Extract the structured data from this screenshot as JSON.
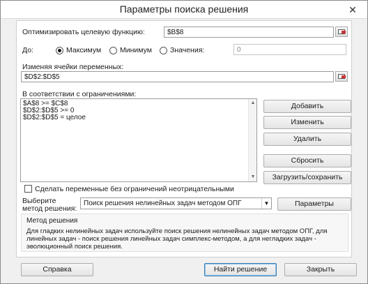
{
  "window": {
    "title": "Параметры поиска решения",
    "close_glyph": "✕"
  },
  "objective": {
    "label": "Оптимизировать целевую функцию:",
    "value": "$B$8"
  },
  "to": {
    "label": "До:",
    "options": [
      {
        "label": "Максимум",
        "checked": true
      },
      {
        "label": "Минимум",
        "checked": false
      },
      {
        "label": "Значения:",
        "checked": false
      }
    ],
    "value_field": "0"
  },
  "variables": {
    "label": "Изменяя ячейки переменных:",
    "value": "$D$2:$D$5"
  },
  "constraints": {
    "label": "В соответствии с ограничениями:",
    "items": [
      "$A$8 >= $C$8",
      "$D$2:$D$5 >= 0",
      "$D$2:$D$5 = целое"
    ]
  },
  "constraint_buttons": {
    "add": "Добавить",
    "change": "Изменить",
    "delete": "Удалить",
    "reset": "Сбросить",
    "load_save": "Загрузить/сохранить"
  },
  "nonneg": {
    "label": "Сделать переменные без ограничений неотрицательными",
    "checked": false
  },
  "method": {
    "label_line1": "Выберите",
    "label_line2": "метод решения:",
    "selected": "Поиск решения нелинейных задач методом ОПГ",
    "params_button": "Параметры",
    "box_title": "Метод решения",
    "description": "Для гладких нелинейных задач используйте поиск решения нелинейных задач методом ОПГ, для линейных задач - поиск решения линейных задач симплекс-методом, а для негладких задач - эволюционный поиск решения."
  },
  "footer": {
    "help": "Справка",
    "solve": "Найти решение",
    "close": "Закрыть"
  },
  "icons": {
    "ref_button": "range-select-icon",
    "dropdown": "chevron-down-icon",
    "scroll_up": "arrow-up-icon",
    "scroll_down": "arrow-down-icon"
  },
  "colors": {
    "window_bg": "#f0f0f0",
    "panel_bg": "#ffffff",
    "primary_border": "#3c7fb1"
  }
}
